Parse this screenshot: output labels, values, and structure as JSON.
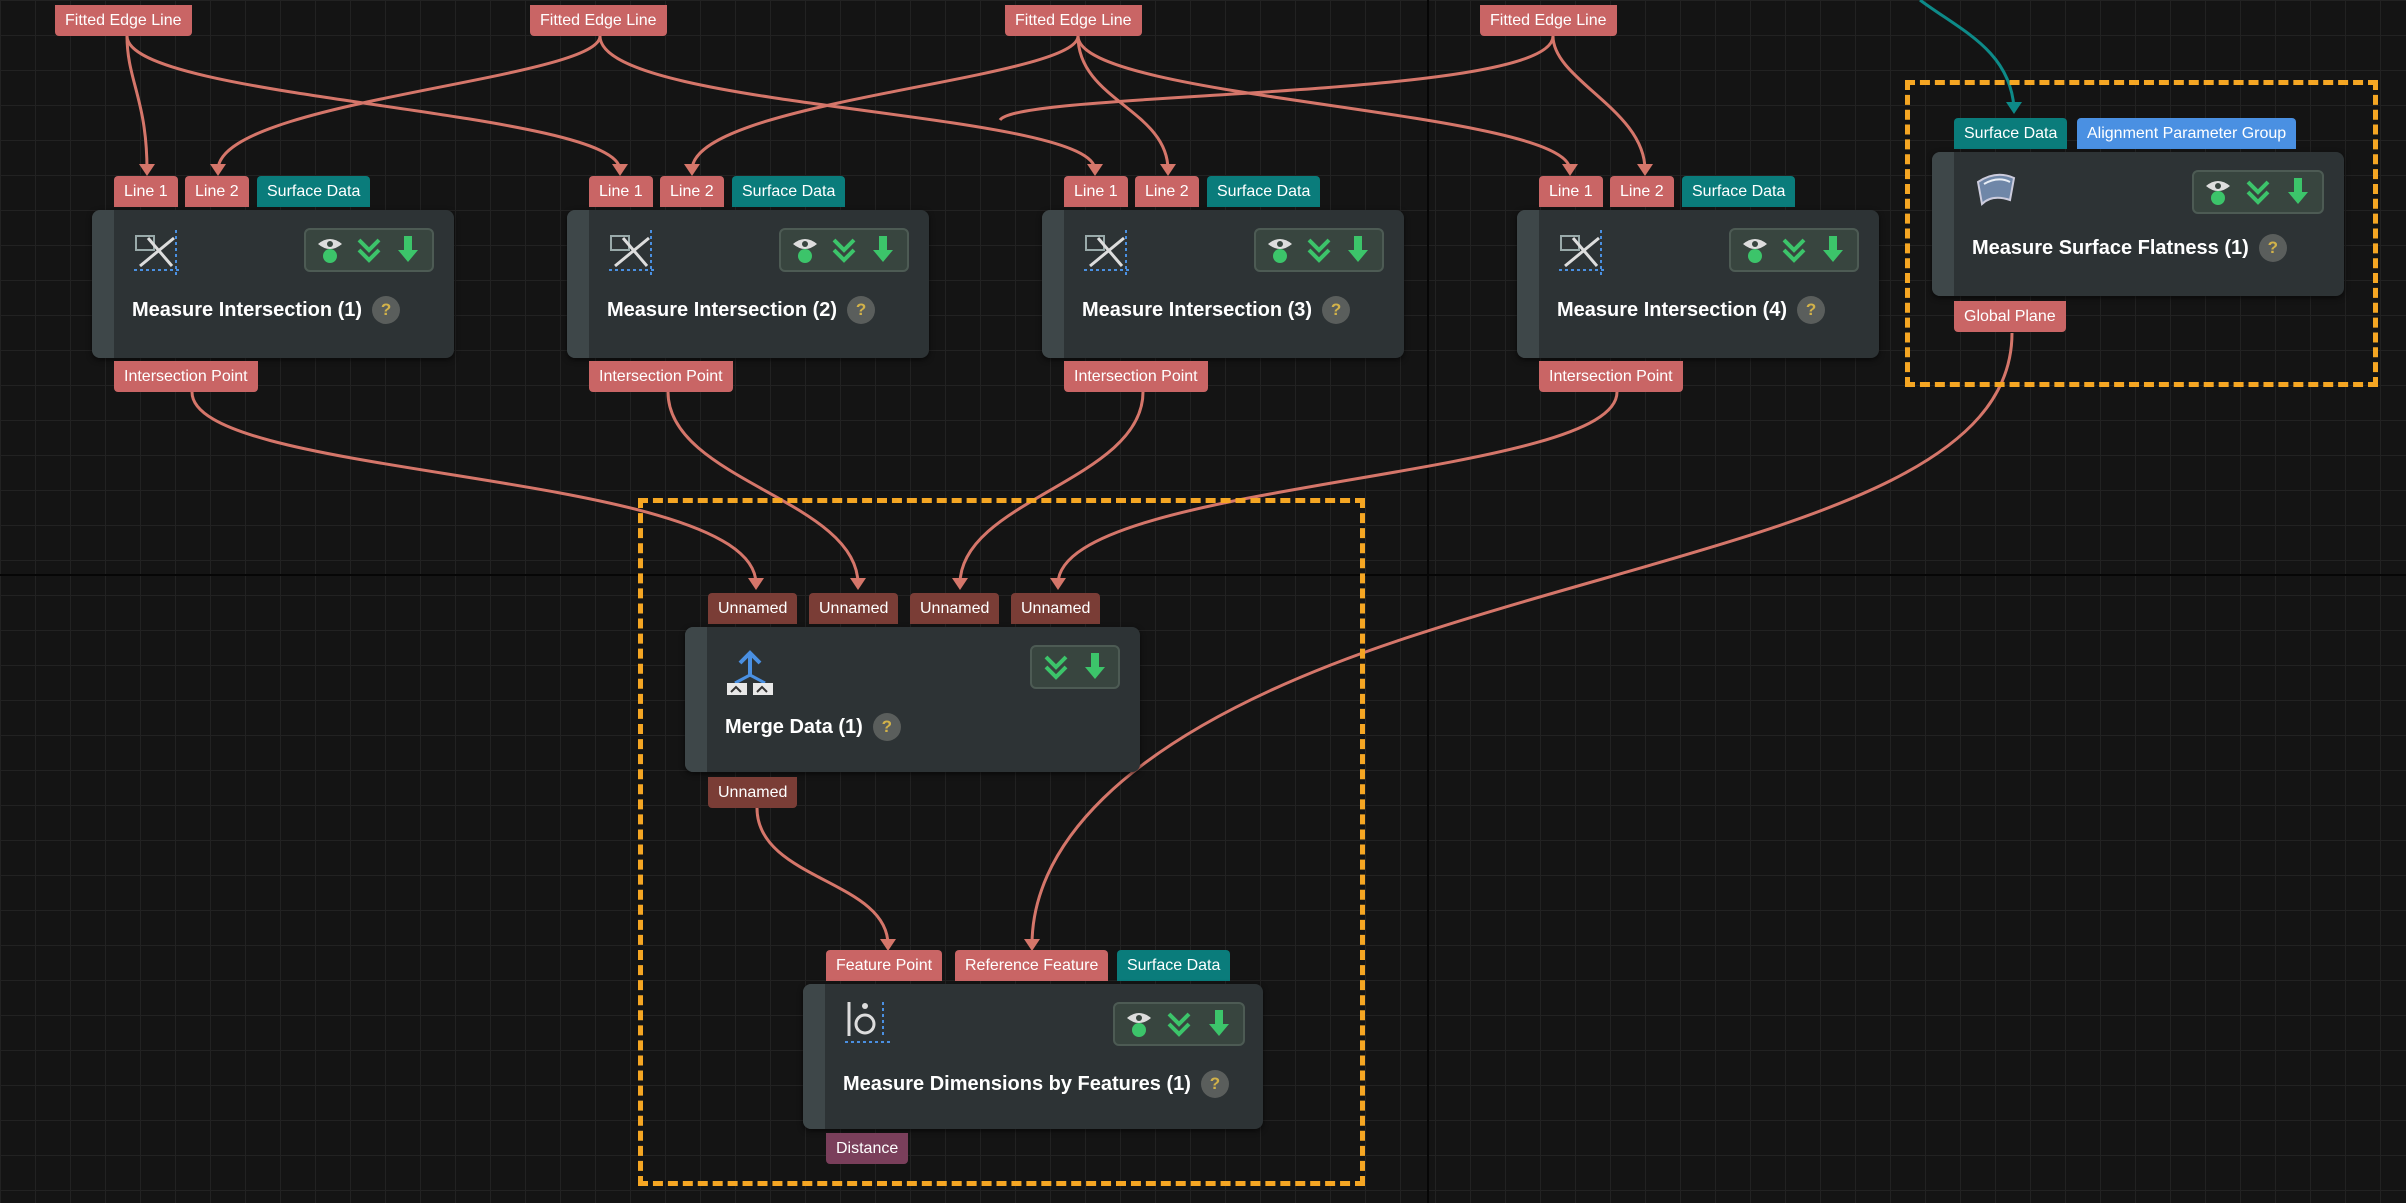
{
  "colors": {
    "background": "#141414",
    "node": "#2d3335",
    "port_red": "#c96565",
    "port_teal": "#0a7c7b",
    "port_blue": "#4a90e2",
    "port_brown": "#7a3d36",
    "port_mauve": "#7a3f5b",
    "group_border": "#f5a623",
    "wire_red": "#d5766a",
    "wire_teal": "#0d8a88"
  },
  "top_outputs": [
    "Fitted Edge Line",
    "Fitted Edge Line",
    "Fitted Edge Line",
    "Fitted Edge Line"
  ],
  "intersections": [
    {
      "title": "Measure Intersection (1)",
      "inputs": [
        "Line 1",
        "Line 2",
        "Surface Data"
      ],
      "output": "Intersection Point"
    },
    {
      "title": "Measure Intersection (2)",
      "inputs": [
        "Line 1",
        "Line 2",
        "Surface Data"
      ],
      "output": "Intersection Point"
    },
    {
      "title": "Measure Intersection (3)",
      "inputs": [
        "Line 1",
        "Line 2",
        "Surface Data"
      ],
      "output": "Intersection Point"
    },
    {
      "title": "Measure Intersection (4)",
      "inputs": [
        "Line 1",
        "Line 2",
        "Surface Data"
      ],
      "output": "Intersection Point"
    }
  ],
  "flatness": {
    "title": "Measure Surface Flatness (1)",
    "inputs": [
      "Surface Data",
      "Alignment Parameter Group"
    ],
    "output": "Global Plane"
  },
  "merge": {
    "title": "Merge Data (1)",
    "inputs": [
      "Unnamed",
      "Unnamed",
      "Unnamed",
      "Unnamed"
    ],
    "output": "Unnamed"
  },
  "dimensions": {
    "title": "Measure Dimensions by Features (1)",
    "inputs": [
      "Feature Point",
      "Reference Feature",
      "Surface Data"
    ],
    "output": "Distance"
  },
  "help_symbol": "?",
  "icons": {
    "visibility": "eye-person-icon",
    "step_into": "double-chevron-down-icon",
    "output": "green-down-arrow-icon"
  }
}
